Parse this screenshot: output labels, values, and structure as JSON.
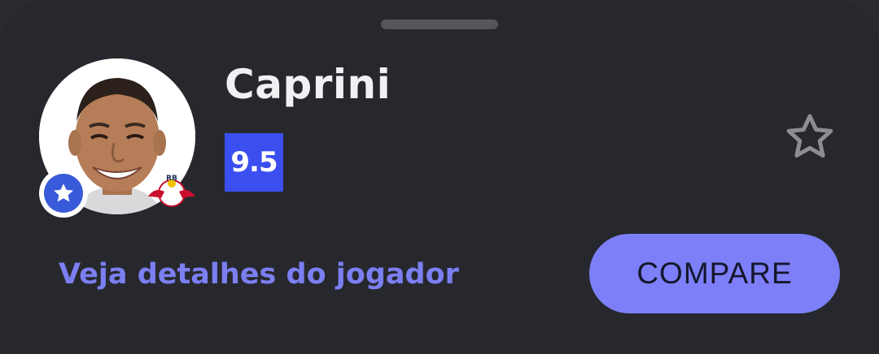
{
  "player": {
    "name": "Caprini",
    "rating": "9.5",
    "avatar_icon": "player-photo",
    "badge_icon": "star-icon",
    "club_logo_icon": "red-bull-bragantino-logo",
    "club_logo_text": "RB"
  },
  "actions": {
    "details_link": "Veja detalhes do jogador",
    "compare_label": "COMPARE",
    "favorite_icon": "star-outline-icon"
  },
  "colors": {
    "background": "#27282d",
    "rating_bg": "#3b4ff0",
    "accent": "#7c7ff7",
    "badge_blue": "#3a5bd9"
  }
}
